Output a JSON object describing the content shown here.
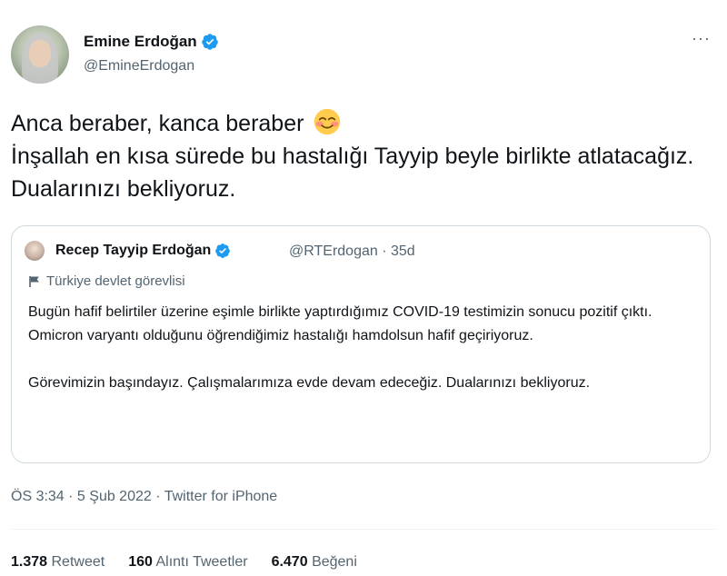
{
  "author": {
    "name": "Emine Erdoğan",
    "handle": "@EmineErdogan",
    "more_label": "···"
  },
  "tweet": {
    "line1": "Anca beraber, kanca beraber",
    "line2": "İnşallah en kısa sürede bu hastalığı Tayyip beyle birlikte atlatacağız. Dualarınızı bekliyoruz."
  },
  "quoted": {
    "name": "Recep Tayyip Erdoğan",
    "meta": "@RTErdogan · 35d",
    "label": "Türkiye devlet görevlisi",
    "para1": "Bugün hafif belirtiler üzerine eşimle birlikte yaptırdığımız COVID-19 testimizin sonucu pozitif çıktı. Omicron varyantı olduğunu öğrendiğimiz hastalığı hamdolsun hafif geçiriyoruz.",
    "para2": "Görevimizin başındayız. Çalışmalarımıza evde devam edeceğiz. Dualarınızı bekliyoruz."
  },
  "timestamp": "ÖS 3:34 · 5 Şub 2022 · Twitter for iPhone",
  "stats": {
    "retweets_count": "1.378",
    "retweets_label": "Retweet",
    "quotes_count": "160",
    "quotes_label": "Alıntı Tweetler",
    "likes_count": "6.470",
    "likes_label": "Beğeni"
  },
  "colors": {
    "verified": "#1d9bf0",
    "secondary_text": "#536471",
    "border": "#cfd9de"
  },
  "icons": {
    "verified": "verified-badge-icon",
    "emoji": "smiling-face-emoji-icon",
    "flag": "flag-icon",
    "more": "more-icon"
  }
}
